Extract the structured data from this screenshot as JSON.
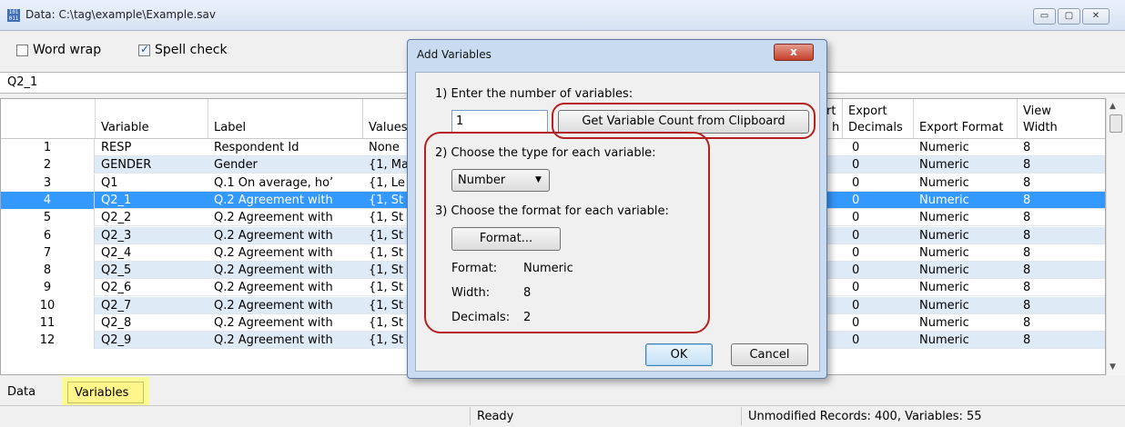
{
  "window": {
    "title": "Data: C:\\tag\\example\\Example.sav",
    "app_icon_text": "101 011",
    "controls": {
      "minimize": "▭",
      "maximize": "▢",
      "close": "✕"
    }
  },
  "toolbar": {
    "word_wrap": {
      "label": "Word wrap",
      "checked": false
    },
    "spell_check": {
      "label": "Spell check",
      "checked": true
    }
  },
  "cell_editor": {
    "value": "Q2_1"
  },
  "grid": {
    "columns": [
      "",
      "Variable",
      "Label",
      "Values",
      "rt\nh",
      "Export\nDecimals",
      "Export Format",
      "View\nWidth"
    ],
    "header": {
      "variable": "Variable",
      "label": "Label",
      "values": "Values",
      "partial": "rt",
      "partial2": "h",
      "export_dec_1": "Export",
      "export_dec_2": "Decimals",
      "export_format": "Export Format",
      "view_width_1": "View",
      "view_width_2": "Width"
    },
    "rows": [
      {
        "n": "1",
        "variable": "RESP",
        "label": "Respondent Id",
        "values": "None",
        "decimals": "0",
        "format": "Numeric",
        "width": "8"
      },
      {
        "n": "2",
        "variable": "GENDER",
        "label": "Gender",
        "values": "{1, Ma",
        "decimals": "0",
        "format": "Numeric",
        "width": "8"
      },
      {
        "n": "3",
        "variable": "Q1",
        "label": "Q.1 On average, ho’",
        "values": "{1, Le",
        "decimals": "0",
        "format": "Numeric",
        "width": "8"
      },
      {
        "n": "4",
        "variable": "Q2_1",
        "label": "Q.2 Agreement with",
        "values": "{1, St",
        "decimals": "0",
        "format": "Numeric",
        "width": "8"
      },
      {
        "n": "5",
        "variable": "Q2_2",
        "label": "Q.2 Agreement with",
        "values": "{1, St",
        "decimals": "0",
        "format": "Numeric",
        "width": "8"
      },
      {
        "n": "6",
        "variable": "Q2_3",
        "label": "Q.2 Agreement with",
        "values": "{1, St",
        "decimals": "0",
        "format": "Numeric",
        "width": "8"
      },
      {
        "n": "7",
        "variable": "Q2_4",
        "label": "Q.2 Agreement with",
        "values": "{1, St",
        "decimals": "0",
        "format": "Numeric",
        "width": "8"
      },
      {
        "n": "8",
        "variable": "Q2_5",
        "label": "Q.2 Agreement with",
        "values": "{1, St",
        "decimals": "0",
        "format": "Numeric",
        "width": "8"
      },
      {
        "n": "9",
        "variable": "Q2_6",
        "label": "Q.2 Agreement with",
        "values": "{1, St",
        "decimals": "0",
        "format": "Numeric",
        "width": "8"
      },
      {
        "n": "10",
        "variable": "Q2_7",
        "label": "Q.2 Agreement with",
        "values": "{1, St",
        "decimals": "0",
        "format": "Numeric",
        "width": "8"
      },
      {
        "n": "11",
        "variable": "Q2_8",
        "label": "Q.2 Agreement with",
        "values": "{1, St",
        "decimals": "0",
        "format": "Numeric",
        "width": "8"
      },
      {
        "n": "12",
        "variable": "Q2_9",
        "label": "Q.2 Agreement with",
        "values": "{1, St",
        "decimals": "0",
        "format": "Numeric",
        "width": "8"
      }
    ],
    "selected_row": "4"
  },
  "tabs": {
    "data": "Data",
    "variables": "Variables"
  },
  "status": {
    "ready": "Ready",
    "info": "Unmodified Records: 400, Variables: 55"
  },
  "dialog": {
    "title": "Add Variables",
    "close": "x",
    "step1": "1) Enter the number of variables:",
    "count_value": "1",
    "clipboard_button": "Get Variable Count from Clipboard",
    "step2": "2) Choose the type for each variable:",
    "type_value": "Number",
    "step3": "3) Choose the format for each variable:",
    "format_button": "Format...",
    "format_key": "Format:",
    "format_value": "Numeric",
    "width_key": "Width:",
    "width_value": "8",
    "decimals_key": "Decimals:",
    "decimals_value": "2",
    "ok": "OK",
    "cancel": "Cancel"
  }
}
